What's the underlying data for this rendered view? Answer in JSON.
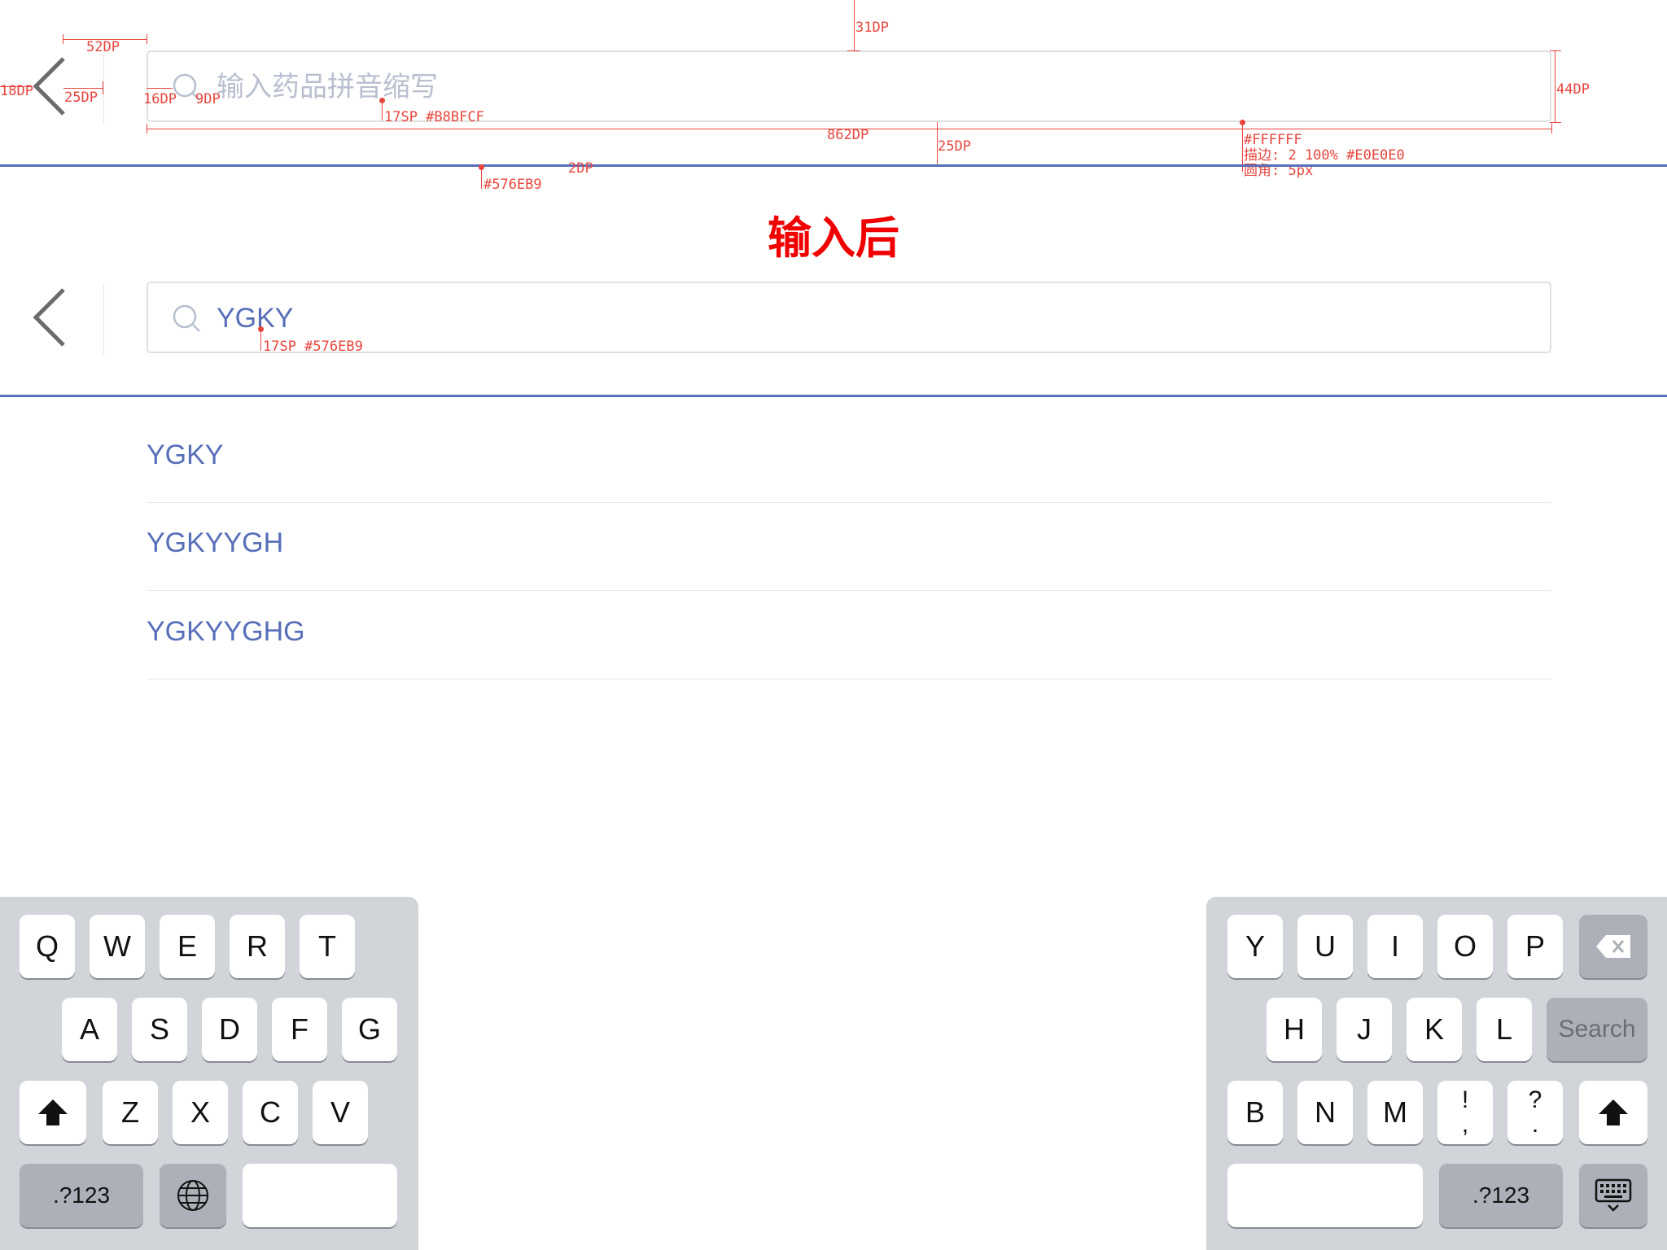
{
  "top_search": {
    "placeholder": "输入药品拼音缩写"
  },
  "annotations": {
    "top_margin": "31DP",
    "back_area_width": "52DP",
    "back_left": "18DP",
    "back_icon_height": "25DP",
    "icon_left_padding": "16DP",
    "icon_text_gap": "9DP",
    "placeholder_spec": "17SP #B8BFCF",
    "box_height": "44DP",
    "box_width": "862DP",
    "bottom_margin": "25DP",
    "box_fill": "#FFFFFF",
    "box_stroke": "描边: 2 100% #E0E0E0",
    "box_radius": "圆角: 5px",
    "line_color": "#576EB9",
    "line_height": "2DP",
    "input_spec": "17SP #576EB9"
  },
  "section_title": "输入后",
  "bottom_search": {
    "value": "YGKY"
  },
  "suggestions": [
    "YGKY",
    "YGKYYGH",
    "YGKYYGHG"
  ],
  "keyboard": {
    "left": {
      "row1": [
        "Q",
        "W",
        "E",
        "R",
        "T"
      ],
      "row2": [
        "A",
        "S",
        "D",
        "F",
        "G"
      ],
      "row3": [
        "Z",
        "X",
        "C",
        "V"
      ],
      "numbers_label": ".?123"
    },
    "right": {
      "row1": [
        "Y",
        "U",
        "I",
        "O",
        "P"
      ],
      "row2": [
        "H",
        "J",
        "K",
        "L"
      ],
      "search_label": "Search",
      "row3": [
        "B",
        "N",
        "M"
      ],
      "punct1_top": "!",
      "punct1_bottom": ",",
      "punct2_top": "?",
      "punct2_bottom": ".",
      "numbers_label": ".?123"
    }
  },
  "colors": {
    "accent": "#576EB9",
    "placeholder": "#B8BFCF",
    "border": "#E0E0E0",
    "annotation": "#E8453C",
    "title": "#F00000"
  }
}
